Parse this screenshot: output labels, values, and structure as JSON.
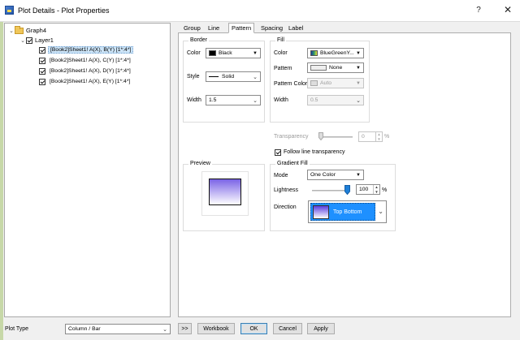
{
  "window": {
    "title": "Plot Details - Plot Properties",
    "help_label": "?",
    "close_label": "✕"
  },
  "tree": {
    "graph": "Graph4",
    "layer": "Layer1",
    "plots": [
      "[Book2]Sheet1! A(X), B(Y) [1*:4*]",
      "[Book2]Sheet1! A(X), C(Y) [1*:4*]",
      "[Book2]Sheet1! A(X), D(Y) [1*:4*]",
      "[Book2]Sheet1! A(X), E(Y) [1*:4*]"
    ]
  },
  "tabs": {
    "group": "Group",
    "line": "Line",
    "pattern": "Pattern",
    "spacing": "Spacing",
    "label": "Label"
  },
  "border": {
    "title": "Border",
    "color_label": "Color",
    "color_value": "Black",
    "color_hex": "#000000",
    "style_label": "Style",
    "style_value": "Solid",
    "width_label": "Width",
    "width_value": "1.5"
  },
  "fill": {
    "title": "Fill",
    "color_label": "Color",
    "color_value": "BlueGreenY...",
    "pattern_label": "Pattern",
    "pattern_value": "None",
    "pattern_color_label": "Pattern Color",
    "pattern_color_value": "Auto",
    "width_label": "Width",
    "width_value": "0.5"
  },
  "transparency": {
    "label": "Transparency",
    "value": "0",
    "unit": "%",
    "follow_label": "Follow line transparency",
    "follow_checked": true
  },
  "preview": {
    "title": "Preview"
  },
  "gradient": {
    "title": "Gradient Fill",
    "mode_label": "Mode",
    "mode_value": "One Color",
    "lightness_label": "Lightness",
    "lightness_value": "100",
    "lightness_unit": "%",
    "direction_label": "Direction",
    "direction_value": "Top Bottom"
  },
  "bottom": {
    "plot_type_label": "Plot Type",
    "plot_type_value": "Column / Bar",
    "collapse_label": ">>",
    "workbook_label": "Workbook",
    "ok_label": "OK",
    "cancel_label": "Cancel",
    "apply_label": "Apply"
  }
}
